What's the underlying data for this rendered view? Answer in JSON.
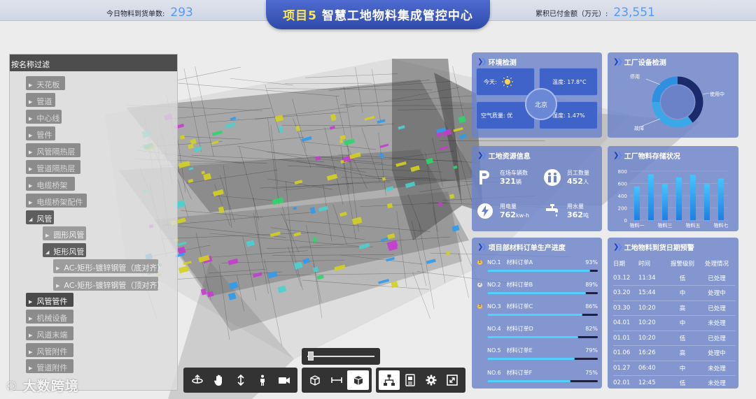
{
  "header": {
    "title_prefix": "项目5",
    "title_main": "智慧工地物料集成管控中心",
    "left_stat_label": "今日物料到货单数:",
    "left_stat_value": "293",
    "right_stat_label": "累积已付金额（万元）:",
    "right_stat_value": "23,551"
  },
  "tree": {
    "filter_label": "按名称过滤",
    "items": [
      {
        "label": "天花板",
        "state": "collapsed",
        "level": 0
      },
      {
        "label": "管道",
        "state": "collapsed",
        "level": 0
      },
      {
        "label": "中心线",
        "state": "collapsed",
        "level": 0
      },
      {
        "label": "管件",
        "state": "collapsed",
        "level": 0
      },
      {
        "label": "风管隔热层",
        "state": "collapsed",
        "level": 0
      },
      {
        "label": "管道隔热层",
        "state": "collapsed",
        "level": 0
      },
      {
        "label": "电缆桥架",
        "state": "collapsed",
        "level": 0
      },
      {
        "label": "电缆桥架配件",
        "state": "collapsed",
        "level": 0
      },
      {
        "label": "风管",
        "state": "expanded",
        "level": 0
      },
      {
        "label": "圆形风管",
        "state": "collapsed",
        "level": 1
      },
      {
        "label": "矩形风管",
        "state": "expanded",
        "level": 1
      },
      {
        "label": "AC-矩形-镀锌钢管（底对齐）",
        "state": "collapsed",
        "level": 2
      },
      {
        "label": "AC-矩形-镀锌钢管（顶对齐）",
        "state": "collapsed",
        "level": 2
      },
      {
        "label": "风管管件",
        "state": "selected",
        "level": 0
      },
      {
        "label": "机械设备",
        "state": "collapsed",
        "level": 0
      },
      {
        "label": "风道末端",
        "state": "collapsed",
        "level": 0
      },
      {
        "label": "风管附件",
        "state": "collapsed",
        "level": 0
      },
      {
        "label": "管道附件",
        "state": "collapsed",
        "level": 0
      }
    ]
  },
  "toolbar": {
    "group1": [
      "orbit-icon",
      "pan-hand-icon",
      "zoom-vertical-icon",
      "person-walk-icon",
      "camera-icon"
    ],
    "group2": [
      "box-section-icon",
      "measure-icon",
      "cube-view-icon"
    ],
    "group3": [
      "model-tree-icon",
      "properties-icon",
      "settings-icon",
      "fullscreen-icon"
    ],
    "slider_value": 0.05
  },
  "watermark": "大数跨境",
  "env": {
    "title": "环境检测",
    "today_label": "今天:",
    "temperature": "温度: 17.8°C",
    "air_quality": "空气质量: 优",
    "humidity": "湿度: 1.47%",
    "city": "北京"
  },
  "equipment": {
    "title": "工厂设备检测",
    "labels": {
      "idle": "停用",
      "in_use": "使用中",
      "fault": "故障"
    },
    "chart_data": {
      "type": "pie",
      "categories": [
        "使用中",
        "停用",
        "故障"
      ],
      "values": [
        40,
        35,
        25
      ],
      "colors": [
        "#1b2a6b",
        "#3aa7e8",
        "#2f8fe0"
      ]
    }
  },
  "resources": {
    "title": "工地资源信息",
    "items": [
      {
        "label": "在场车辆数",
        "value": "321",
        "unit": "辆",
        "icon": "parking-icon"
      },
      {
        "label": "员工数量",
        "value": "452",
        "unit": "人",
        "icon": "staff-icon"
      },
      {
        "label": "用电量",
        "value": "762",
        "unit": "kw-h",
        "icon": "electric-icon"
      },
      {
        "label": "用水量",
        "value": "362",
        "unit": "吨",
        "icon": "water-tap-icon"
      }
    ]
  },
  "storage": {
    "title": "工厂物料存储状况",
    "chart_data": {
      "type": "bar",
      "categories": [
        "物料一",
        "",
        "物料三",
        "",
        "物料五",
        "",
        "物料七"
      ],
      "x_labels": [
        "物料一",
        "物料三",
        "物料五",
        "物料七"
      ],
      "values": [
        550,
        750,
        590,
        700,
        740,
        590,
        680
      ],
      "yticks": [
        0,
        200,
        400,
        600,
        800
      ],
      "ylim": [
        0,
        800
      ]
    }
  },
  "progress": {
    "title": "项目部材料订单生产进度",
    "items": [
      {
        "no": "NO.1",
        "name": "材料订单A",
        "pct": "93%",
        "value": 93,
        "dot": "#f2c14e",
        "mark": "1"
      },
      {
        "no": "NO.2",
        "name": "材料订单B",
        "pct": "89%",
        "value": 89,
        "dot": "#e0e0e0",
        "mark": "2"
      },
      {
        "no": "NO.3",
        "name": "材料订单C",
        "pct": "86%",
        "value": 86,
        "dot": "#f2c14e",
        "mark": "3"
      },
      {
        "no": "NO.4",
        "name": "材料订单D",
        "pct": "82%",
        "value": 82,
        "dot": "",
        "mark": ""
      },
      {
        "no": "NO.5",
        "name": "材料订单E",
        "pct": "79%",
        "value": 79,
        "dot": "",
        "mark": ""
      },
      {
        "no": "NO.6",
        "name": "材料订单F",
        "pct": "75%",
        "value": 75,
        "dot": "",
        "mark": ""
      }
    ]
  },
  "arrival": {
    "title": "工地物料到货日期预警",
    "columns": [
      "日期",
      "时间",
      "报警级别",
      "处理情况"
    ],
    "rows": [
      [
        "03.12",
        "11:34",
        "低",
        "已处理"
      ],
      [
        "03.20",
        "15:44",
        "中",
        "处理中"
      ],
      [
        "03.30",
        "10:20",
        "高",
        "已处理"
      ],
      [
        "04.01",
        "10:20",
        "中",
        "未处理"
      ],
      [
        "01.01",
        "10:20",
        "低",
        "已处理"
      ],
      [
        "01.06",
        "16:26",
        "高",
        "处理中"
      ],
      [
        "01.27",
        "06:40",
        "中",
        "未处理"
      ],
      [
        "02.01",
        "12:45",
        "低",
        "未处理"
      ]
    ]
  }
}
